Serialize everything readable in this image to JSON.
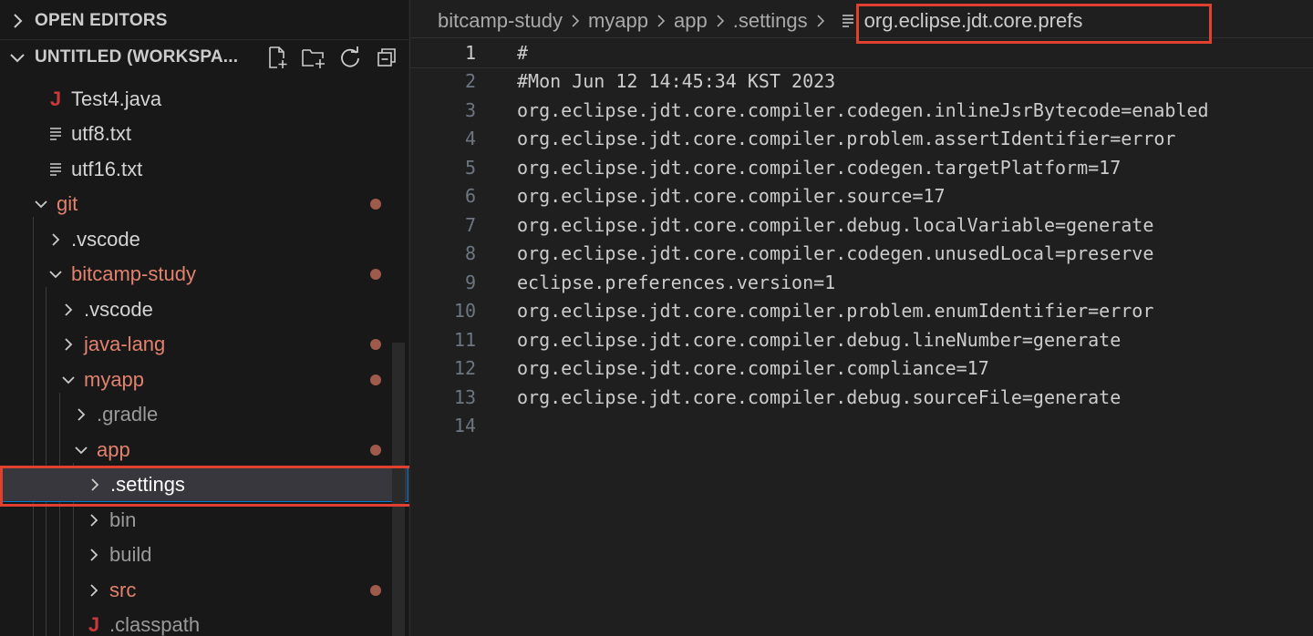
{
  "sidebar": {
    "open_editors_title": "OPEN EDITORS",
    "workspace_title": "UNTITLED (WORKSPA...",
    "actions": [
      {
        "icon": "new-file-icon"
      },
      {
        "icon": "new-folder-icon"
      },
      {
        "icon": "refresh-icon"
      },
      {
        "icon": "collapse-all-icon"
      }
    ],
    "tree": [
      {
        "label": "Test4.java",
        "kind": "java-file",
        "color": "norm",
        "modified": false
      },
      {
        "label": "utf8.txt",
        "kind": "text-file",
        "color": "norm",
        "modified": false
      },
      {
        "label": "utf16.txt",
        "kind": "text-file",
        "color": "norm",
        "modified": false
      },
      {
        "label": "git",
        "kind": "folder-open",
        "color": "mod",
        "modified": true
      },
      {
        "label": ".vscode",
        "kind": "folder-closed",
        "color": "norm",
        "modified": false
      },
      {
        "label": "bitcamp-study",
        "kind": "folder-open",
        "color": "mod",
        "modified": true
      },
      {
        "label": ".vscode",
        "kind": "folder-closed",
        "color": "norm",
        "modified": false
      },
      {
        "label": "java-lang",
        "kind": "folder-closed",
        "color": "mod",
        "modified": true
      },
      {
        "label": "myapp",
        "kind": "folder-open",
        "color": "mod",
        "modified": true
      },
      {
        "label": ".gradle",
        "kind": "folder-closed",
        "color": "dim",
        "modified": false
      },
      {
        "label": "app",
        "kind": "folder-open",
        "color": "mod",
        "modified": true
      },
      {
        "label": ".settings",
        "kind": "folder-closed",
        "color": "norm",
        "modified": false,
        "selected": true
      },
      {
        "label": "bin",
        "kind": "folder-closed",
        "color": "dim",
        "modified": false
      },
      {
        "label": "build",
        "kind": "folder-closed",
        "color": "dim",
        "modified": false
      },
      {
        "label": "src",
        "kind": "folder-closed",
        "color": "mod",
        "modified": true
      },
      {
        "label": ".classpath",
        "kind": "java-file",
        "color": "dim",
        "modified": false
      }
    ]
  },
  "breadcrumb": {
    "items": [
      "bitcamp-study",
      "myapp",
      "app",
      ".settings"
    ],
    "current": "org.eclipse.jdt.core.prefs"
  },
  "editor": {
    "current_line": 1,
    "lines": [
      {
        "n": "1",
        "text": "#"
      },
      {
        "n": "2",
        "text": "#Mon Jun 12 14:45:34 KST 2023"
      },
      {
        "n": "3",
        "text": "org.eclipse.jdt.core.compiler.codegen.inlineJsrBytecode=enabled"
      },
      {
        "n": "4",
        "text": "org.eclipse.jdt.core.compiler.problem.assertIdentifier=error"
      },
      {
        "n": "5",
        "text": "org.eclipse.jdt.core.compiler.codegen.targetPlatform=17"
      },
      {
        "n": "6",
        "text": "org.eclipse.jdt.core.compiler.source=17"
      },
      {
        "n": "7",
        "text": "org.eclipse.jdt.core.compiler.debug.localVariable=generate"
      },
      {
        "n": "8",
        "text": "org.eclipse.jdt.core.compiler.codegen.unusedLocal=preserve"
      },
      {
        "n": "9",
        "text": "eclipse.preferences.version=1"
      },
      {
        "n": "10",
        "text": "org.eclipse.jdt.core.compiler.problem.enumIdentifier=error"
      },
      {
        "n": "11",
        "text": "org.eclipse.jdt.core.compiler.debug.lineNumber=generate"
      },
      {
        "n": "12",
        "text": "org.eclipse.jdt.core.compiler.compliance=17"
      },
      {
        "n": "13",
        "text": "org.eclipse.jdt.core.compiler.debug.sourceFile=generate"
      },
      {
        "n": "14",
        "text": ""
      }
    ]
  },
  "colors": {
    "modified": "#e2826e",
    "highlight": "#e0412e",
    "selection_border": "#0078d4",
    "java_icon": "#c7393b"
  }
}
